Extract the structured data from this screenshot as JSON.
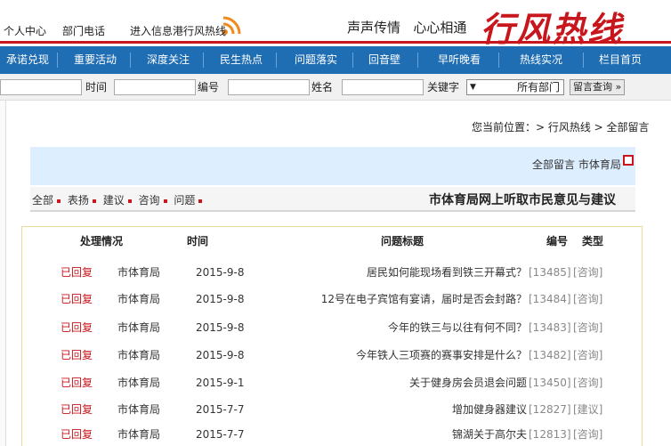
{
  "header": {
    "logo": "行风热线",
    "slogan1": "心心相通",
    "slogan2": "声声传情",
    "notice": "进入信息港行风热线",
    "links": [
      "部门电话",
      "个人中心"
    ]
  },
  "nav": [
    "栏目首页",
    "热线实况",
    "早听晚看",
    "回音壁",
    "问题落实",
    "民生热点",
    "深度关注",
    "重要活动",
    "承诺兑现"
  ],
  "search": {
    "dept_button": "留言查询 »",
    "dept_select": "所有部门",
    "keyword_label": "关键字",
    "name_label": "姓名",
    "id_label": "编号",
    "time_label": "时间"
  },
  "breadcrumb": "您当前位置：> 行风热线 > 全部留言",
  "info": {
    "dept": "市体育局",
    "all": "全部留言"
  },
  "section": {
    "title": "市体育局网上听取市民意见与建议",
    "filters": [
      "问题",
      "咨询",
      "建议",
      "表扬",
      "全部"
    ]
  },
  "table": {
    "headers": {
      "type": "类型",
      "id": "编号",
      "title": "问题标题",
      "time": "时间",
      "status": "处理情况"
    },
    "rows": [
      {
        "type": "[咨询]",
        "id": "[13485]",
        "title": "居民如何能现场看到铁三开幕式？",
        "date": "2015-9-8",
        "dept": "市体育局",
        "status": "已回复"
      },
      {
        "type": "[咨询]",
        "id": "[13484]",
        "title": "12号在电子宾馆有宴请，届时是否会封路？",
        "date": "2015-9-8",
        "dept": "市体育局",
        "status": "已回复"
      },
      {
        "type": "[咨询]",
        "id": "[13483]",
        "title": "今年的铁三与以往有何不同？",
        "date": "2015-9-8",
        "dept": "市体育局",
        "status": "已回复"
      },
      {
        "type": "[咨询]",
        "id": "[13482]",
        "title": "今年铁人三项赛的赛事安排是什么？",
        "date": "2015-9-8",
        "dept": "市体育局",
        "status": "已回复"
      },
      {
        "type": "[咨询]",
        "id": "[13450]",
        "title": "关于健身房会员退会问题",
        "date": "2015-9-1",
        "dept": "市体育局",
        "status": "已回复"
      },
      {
        "type": "[建议]",
        "id": "[12827]",
        "title": "增加健身器建议",
        "date": "2015-7-7",
        "dept": "市体育局",
        "status": "已回复"
      },
      {
        "type": "[咨询]",
        "id": "[12813]",
        "title": "锦湖关于高尔夫",
        "date": "2015-7-7",
        "dept": "市体育局",
        "status": "已回复"
      }
    ]
  },
  "colors": {
    "brand_red": "#c8161d",
    "nav_blue": "#1f6db3",
    "info_bg": "#ddeeff"
  }
}
